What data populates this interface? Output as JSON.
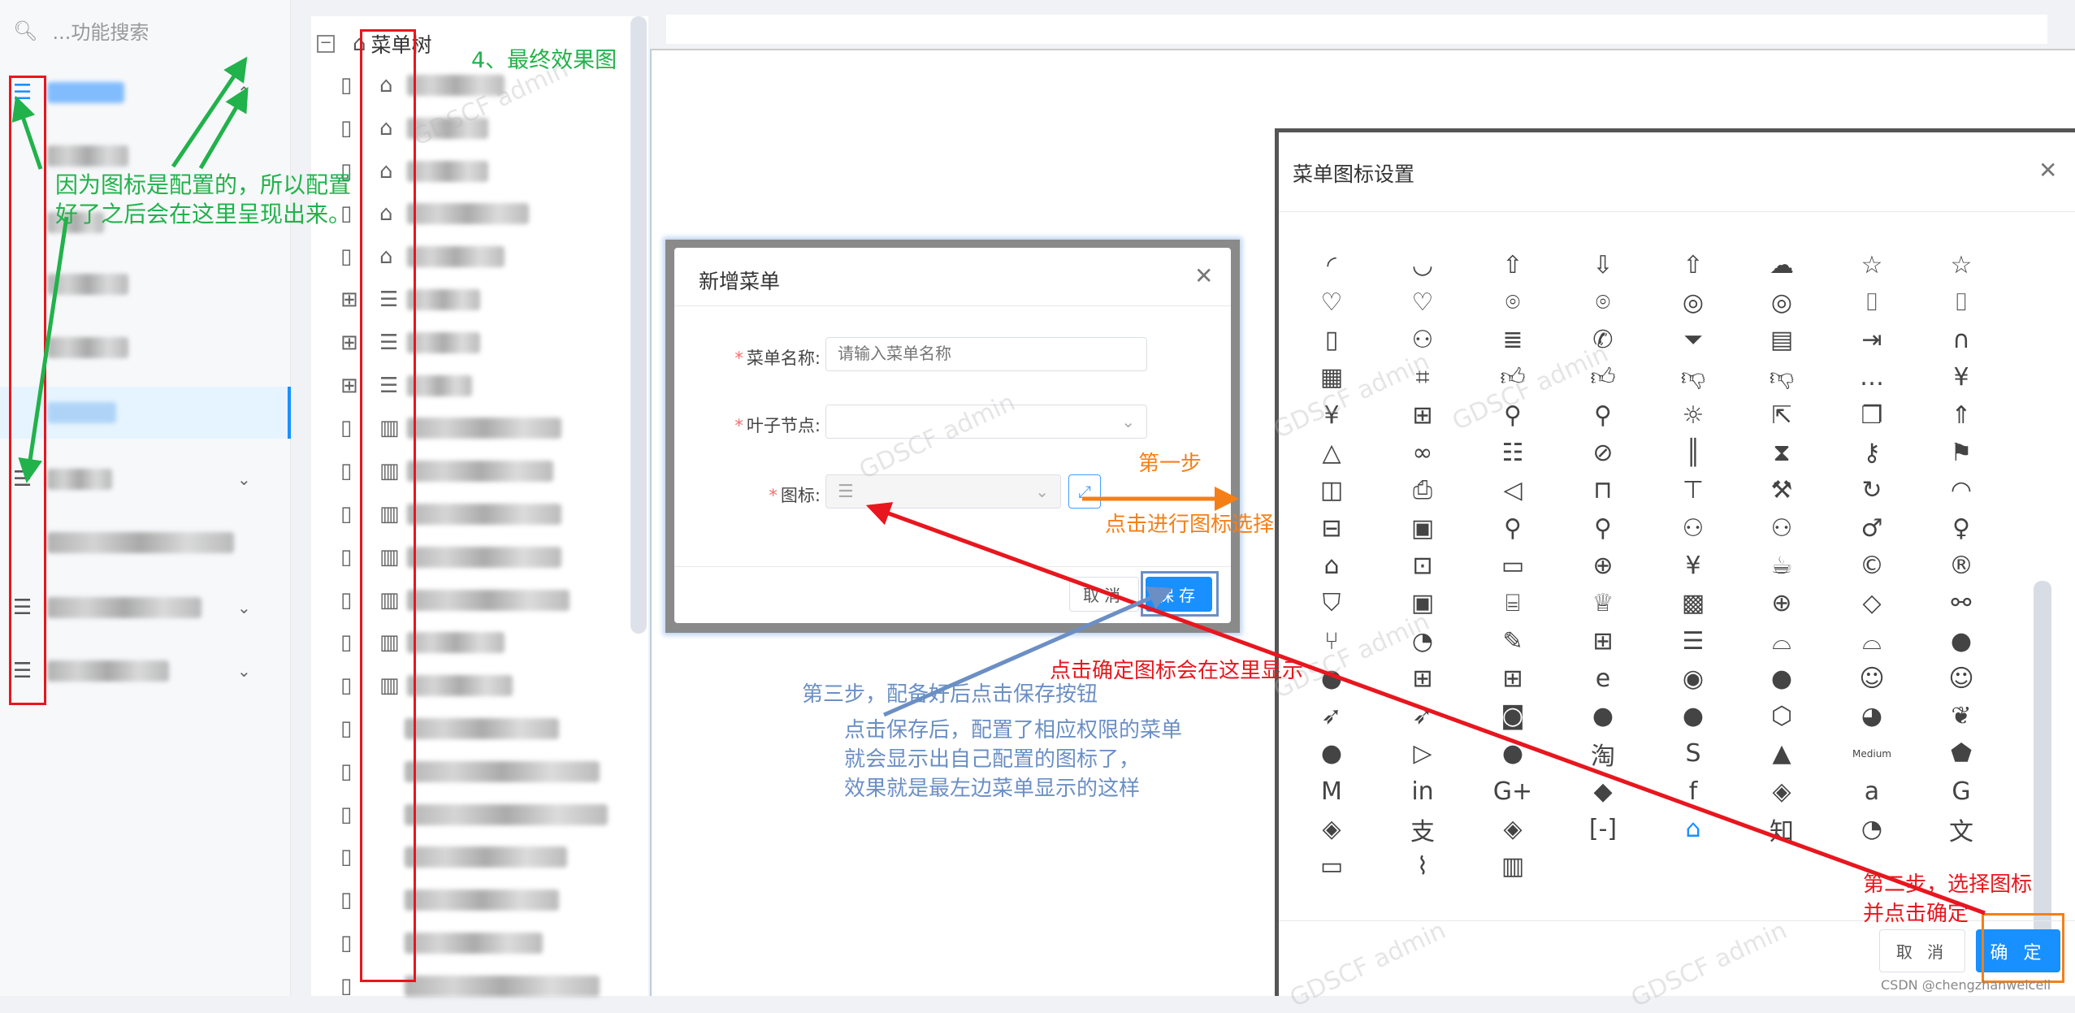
{
  "sidebar": {
    "search_placeholder": "...功能搜索",
    "search_icon": "search-icon",
    "active_color": "#1890ff"
  },
  "tree": {
    "root_label": "菜单树"
  },
  "bg_watermark": "GDSCF admin",
  "add_menu_dialog": {
    "title": "新增菜单",
    "fields": {
      "name_label": "菜单名称:",
      "name_placeholder": "请输入菜单名称",
      "leaf_label": "叶子节点:",
      "icon_label": "图标:"
    },
    "cancel_label": "取消",
    "save_label": "保存"
  },
  "icon_dialog": {
    "title": "菜单图标设置",
    "cancel_label": "取 消",
    "ok_label": "确 定",
    "selected_icon": "home",
    "icons": [
      "loading-3-quarters",
      "loading",
      "cloud-upload",
      "cloud-download",
      "cloud-upload",
      "cloud",
      "star",
      "star",
      "heart",
      "heart",
      "environment",
      "environment",
      "eye",
      "eye",
      "camera",
      "camera",
      "save",
      "team",
      "solution",
      "phone",
      "filter",
      "exception",
      "export",
      "customer-service",
      "qrcode",
      "scan",
      "like",
      "like",
      "dislike",
      "dislike",
      "message",
      "pay-circle",
      "pay-circle",
      "calculator",
      "pushpin",
      "pushpin",
      "bulb",
      "select",
      "switcher",
      "rocket",
      "bell",
      "disconnect",
      "database",
      "compass",
      "barcode",
      "hourglass",
      "key",
      "flag",
      "layout",
      "printer",
      "sound",
      "usb",
      "skin",
      "tool",
      "sync",
      "wifi",
      "car",
      "schedule",
      "user-add",
      "user-delete",
      "usergroup-add",
      "usergroup-delete",
      "man",
      "woman",
      "shop",
      "gift",
      "idcard",
      "medicine-box",
      "red-envelope",
      "coffee",
      "copyright",
      "registered",
      "safety",
      "wallet",
      "bank",
      "trophy",
      "contacts",
      "global",
      "tag",
      "api",
      "fork",
      "dashboard",
      "edit",
      "table",
      "profile",
      "android",
      "android",
      "apple",
      "apple",
      "windows",
      "appstore",
      "ie",
      "chrome",
      "github",
      "aliwangwang",
      "aliwangwang",
      "dingding",
      "dingding",
      "weibo-square",
      "weibo-circle",
      "taobao-circle",
      "html5",
      "weibo",
      "twitter",
      "wechat",
      "youtube",
      "alipay-circle",
      "taobao",
      "skype",
      "qq",
      "medium-workmark",
      "gitlab",
      "medium",
      "linkedin",
      "google-plus",
      "dropbox",
      "facebook",
      "codepen",
      "amazon",
      "google",
      "codepen-circle",
      "alipay",
      "ant-design",
      "aliyun",
      "home",
      "zhihu",
      "dashboard",
      "translation",
      "fund",
      "line-chart",
      "bar-chart"
    ]
  },
  "annotations": {
    "final_result": "4、最终效果图",
    "green_line1": "因为图标是配置的，所以配置",
    "green_line2": "好了之后会在这里呈现出来。",
    "step1": "第一步",
    "step1_desc": "点击进行图标选择",
    "confirm_shows_here": "点击确定图标会在这里显示",
    "step2_line1": "第二步，选择图标",
    "step2_line2": "并点击确定",
    "step3": "第三步，配备好后点击保存按钮",
    "result_line1": "点击保存后，配置了相应权限的菜单",
    "result_line2": "就会显示出自己配置的图标了，",
    "result_line3": "效果就是最左边菜单显示的这样",
    "colors": {
      "green": "#21b24b",
      "red": "#e8161e",
      "orange": "#f57f17",
      "blue": "#6b8fc4"
    }
  },
  "credit": "CSDN @chengzhanweicell"
}
